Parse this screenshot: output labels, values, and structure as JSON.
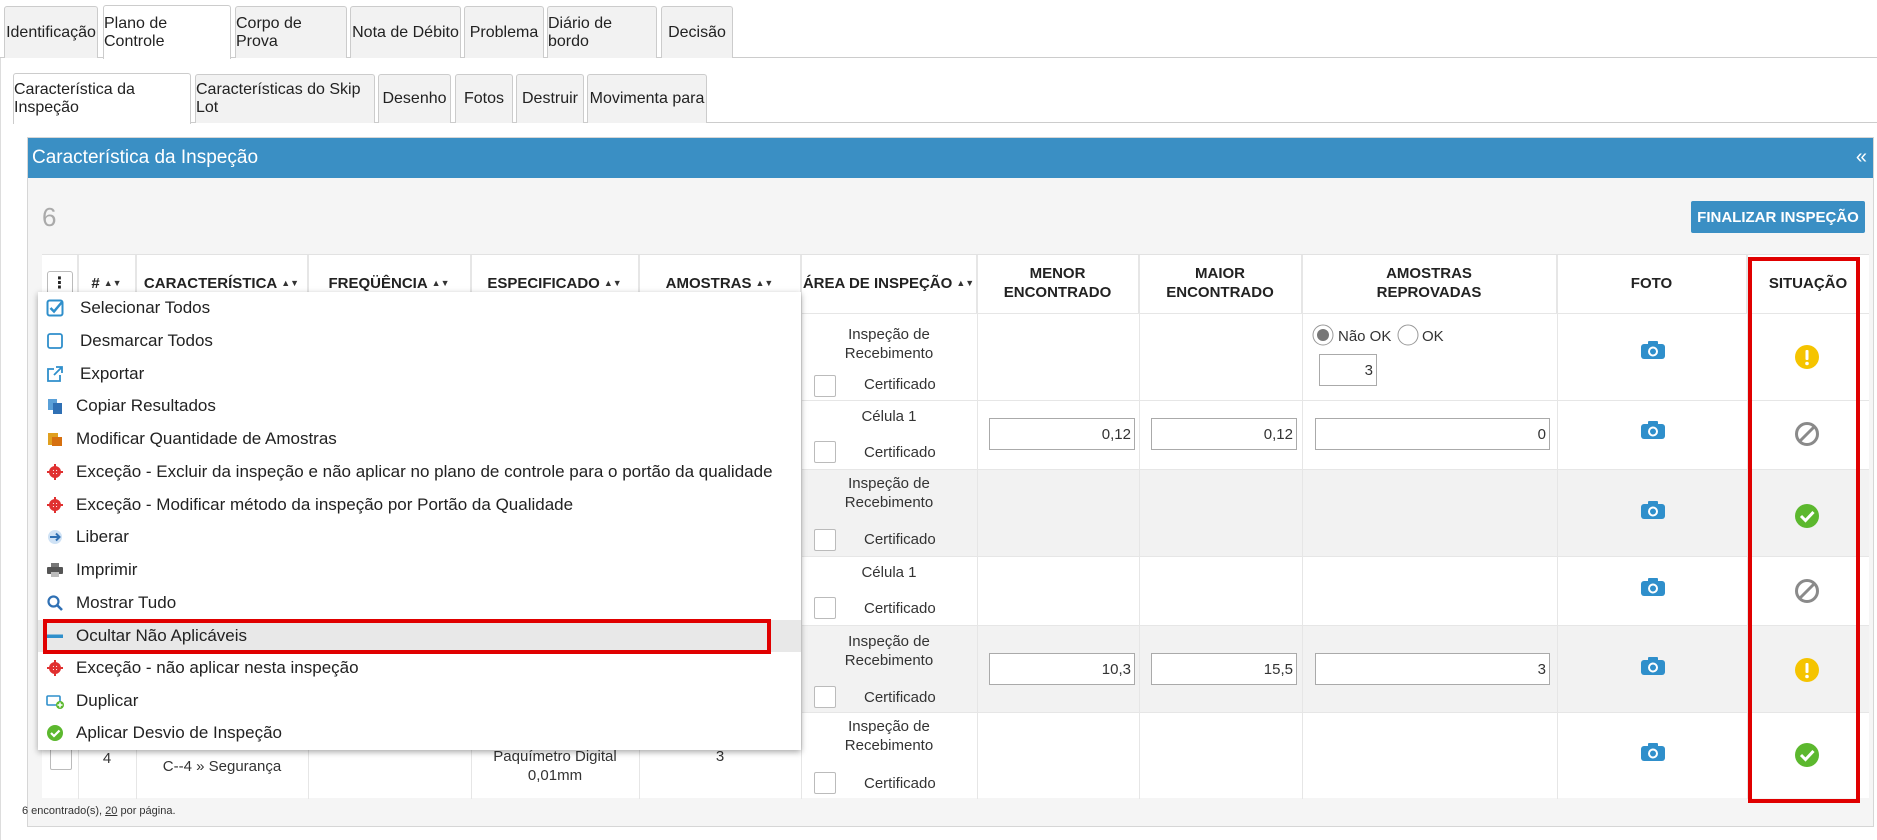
{
  "tabs_main": [
    {
      "label": "Identificação"
    },
    {
      "label": "Plano de Controle"
    },
    {
      "label": "Corpo de Prova"
    },
    {
      "label": "Nota de Débito"
    },
    {
      "label": "Problema"
    },
    {
      "label": "Diário de bordo"
    },
    {
      "label": "Decisão"
    }
  ],
  "tabs_sub": [
    {
      "label": "Característica da Inspeção"
    },
    {
      "label": "Características do Skip Lot"
    },
    {
      "label": "Desenho"
    },
    {
      "label": "Fotos"
    },
    {
      "label": "Destruir"
    },
    {
      "label": "Movimenta para"
    }
  ],
  "panel": {
    "title": "Característica da Inspeção",
    "collapse": "«",
    "count": "6",
    "finalize_label": "FINALIZAR INSPEÇÃO"
  },
  "columns": {
    "menu": "⋮",
    "num": "#",
    "caracteristica": "CARACTERÍSTICA",
    "frequencia": "FREQÜÊNCIA",
    "especificado": "ESPECIFICADO",
    "amostras": "AMOSTRAS",
    "area": "ÁREA DE INSPEÇÃO",
    "menor1": "MENOR",
    "menor2": "ENCONTRADO",
    "maior1": "MAIOR",
    "maior2": "ENCONTRADO",
    "reprov1": "AMOSTRAS",
    "reprov2": "REPROVADAS",
    "foto": "FOTO",
    "situacao": "SITUAÇÃO",
    "sort": "▲▼"
  },
  "rows": [
    {
      "area1": "Inspeção de",
      "area2": "Recebimento",
      "cert": "Certificado",
      "radio_nao": "Não OK",
      "radio_ok": "OK",
      "reprov": "3",
      "status": "warning"
    },
    {
      "area1": "Célula 1",
      "area2": "",
      "cert": "Certificado",
      "menor": "0,12",
      "maior": "0,12",
      "reprov": "0",
      "status": "blocked"
    },
    {
      "area1": "Inspeção de",
      "area2": "Recebimento",
      "cert": "Certificado",
      "status": "ok"
    },
    {
      "area1": "Célula 1",
      "area2": "",
      "cert": "Certificado",
      "status": "blocked"
    },
    {
      "area1": "Inspeção de",
      "area2": "Recebimento",
      "cert": "Certificado",
      "menor": "10,3",
      "maior": "15,5",
      "reprov": "3",
      "status": "warning"
    },
    {
      "num": "4",
      "caract": "C--4 » Segurança",
      "espec1": "Paquímetro Digital",
      "espec2": "0,01mm",
      "amostras": "3",
      "area1": "Inspeção de",
      "area2": "Recebimento",
      "cert": "Certificado",
      "status": "ok"
    }
  ],
  "footer": {
    "text_pre": "6 encontrado(s), ",
    "per_page": "20",
    "text_post": " por página."
  },
  "menu": [
    {
      "label": "Selecionar Todos",
      "icon": "checkbox-checked-icon"
    },
    {
      "label": "Desmarcar Todos",
      "icon": "checkbox-empty-icon"
    },
    {
      "label": "Exportar",
      "icon": "export-icon"
    },
    {
      "label": "Copiar Resultados",
      "icon": "copy-icon"
    },
    {
      "label": "Modificar Quantidade de Amostras",
      "icon": "samples-icon"
    },
    {
      "label": "Exceção - Excluir da inspeção e não aplicar no plano de controle para o portão da qualidade",
      "icon": "gear-icon"
    },
    {
      "label": "Exceção - Modificar método da inspeção por Portão da Qualidade",
      "icon": "gear-icon"
    },
    {
      "label": "Liberar",
      "icon": "release-arrow-icon"
    },
    {
      "label": "Imprimir",
      "icon": "printer-icon"
    },
    {
      "label": "Mostrar Tudo",
      "icon": "search-icon"
    },
    {
      "label": "Ocultar Não Aplicáveis",
      "icon": "minus-icon"
    },
    {
      "label": "Exceção - não aplicar nesta inspeção",
      "icon": "gear-icon"
    },
    {
      "label": "Duplicar",
      "icon": "duplicate-icon"
    },
    {
      "label": "Aplicar Desvio de Inspeção",
      "icon": "check-circle-icon"
    }
  ],
  "colors": {
    "header_blue": "#3a8fc4",
    "highlight_red": "#e00000",
    "warning_yellow": "#f5c400",
    "ok_green": "#5cb82e",
    "blocked_gray": "#8a8a8a"
  }
}
